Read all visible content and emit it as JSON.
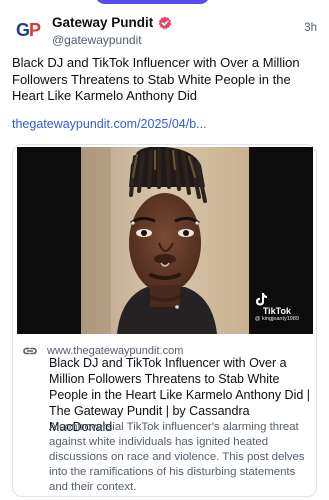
{
  "colors": {
    "accent": "#5b4cf0",
    "link": "#2f5fd8",
    "verified": "#e8456a",
    "muted_text": "#55606c"
  },
  "post": {
    "author": {
      "avatar_text_g": "G",
      "avatar_text_p": "P",
      "display_name": "Gateway Pundit",
      "handle": "@gatewaypundit",
      "verified_icon": "verified-badge-icon"
    },
    "time": "3h",
    "text": "Black DJ and TikTok Influencer with Over a Million Followers Threatens to Stab White People in the Heart Like Karmelo Anthony Did",
    "link_text": "thegatewaypundit.com/2025/04/b..."
  },
  "card": {
    "thumbnail_overlay": {
      "app_name": "TikTok",
      "username": "@ kingjeanty1989"
    },
    "link_icon": "link-icon",
    "domain": "www.thegatewaypundit.com",
    "title": "Black DJ and TikTok Influencer with Over a Million Followers Threatens to Stab White People in the Heart Like Karmelo Anthony Did | The Gateway Pundit | by Cassandra MacDonald",
    "description": "A controversial TikTok influencer's alarming threat against white individuals has ignited heated discussions on race and violence. This post delves into the ramifications of his disturbing statements and their context."
  }
}
